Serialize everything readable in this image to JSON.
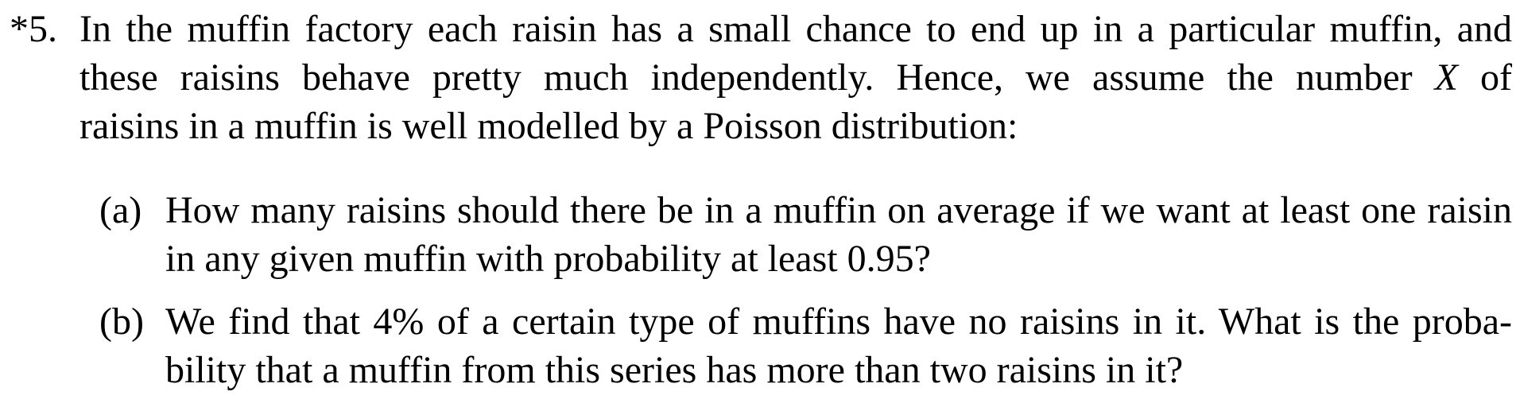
{
  "problem": {
    "number": "*5.",
    "intro_lines": {
      "line1": "In the muffin factory each raisin has a small chance to end up in a particular muffin, and",
      "line2_before_var": "these raisins behave pretty much independently.  Hence, we assume the number ",
      "line2_var": "X",
      "line2_after_var": " of",
      "line3": "raisins in a muffin is well modelled by a Poisson distribution:"
    },
    "parts": [
      {
        "label": "(a)",
        "line1": "How many raisins should there be in a muffin on average if we want at least one raisin",
        "line2": "in any given muffin with probability at least 0.95?"
      },
      {
        "label": "(b)",
        "line1": "We find that 4% of a certain type of muffins have no raisins in it. What is the proba-",
        "line2": "bility that a muffin from this series has more than two raisins in it?"
      }
    ]
  }
}
